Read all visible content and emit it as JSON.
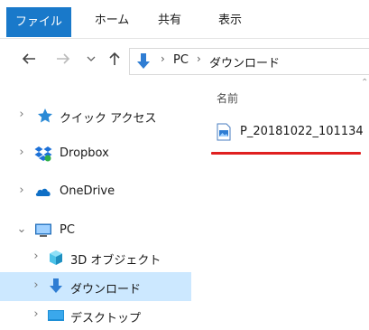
{
  "ribbon": {
    "tabs": [
      {
        "label": "ファイル"
      },
      {
        "label": "ホーム"
      },
      {
        "label": "共有"
      },
      {
        "label": "表示"
      }
    ]
  },
  "address": {
    "crumbs": [
      "PC",
      "ダウンロード"
    ]
  },
  "nav": {
    "items": [
      {
        "label": "クイック アクセス",
        "icon": "star-icon"
      },
      {
        "label": "Dropbox",
        "icon": "dropbox-icon"
      },
      {
        "label": "OneDrive",
        "icon": "onedrive-icon"
      },
      {
        "label": "PC",
        "icon": "pc-icon",
        "expanded": true
      },
      {
        "label": "3D オブジェクト",
        "icon": "3d-objects-icon"
      },
      {
        "label": "ダウンロード",
        "icon": "download-folder-icon",
        "selected": true
      },
      {
        "label": "デスクトップ",
        "icon": "desktop-folder-icon"
      }
    ]
  },
  "content": {
    "column_header": "名前",
    "files": [
      {
        "name": "P_20181022_101134",
        "icon": "image-file-icon"
      }
    ]
  },
  "colors": {
    "file_tab": "#1979ca",
    "selection": "#cce8ff",
    "highlight_underline": "#e02020"
  }
}
